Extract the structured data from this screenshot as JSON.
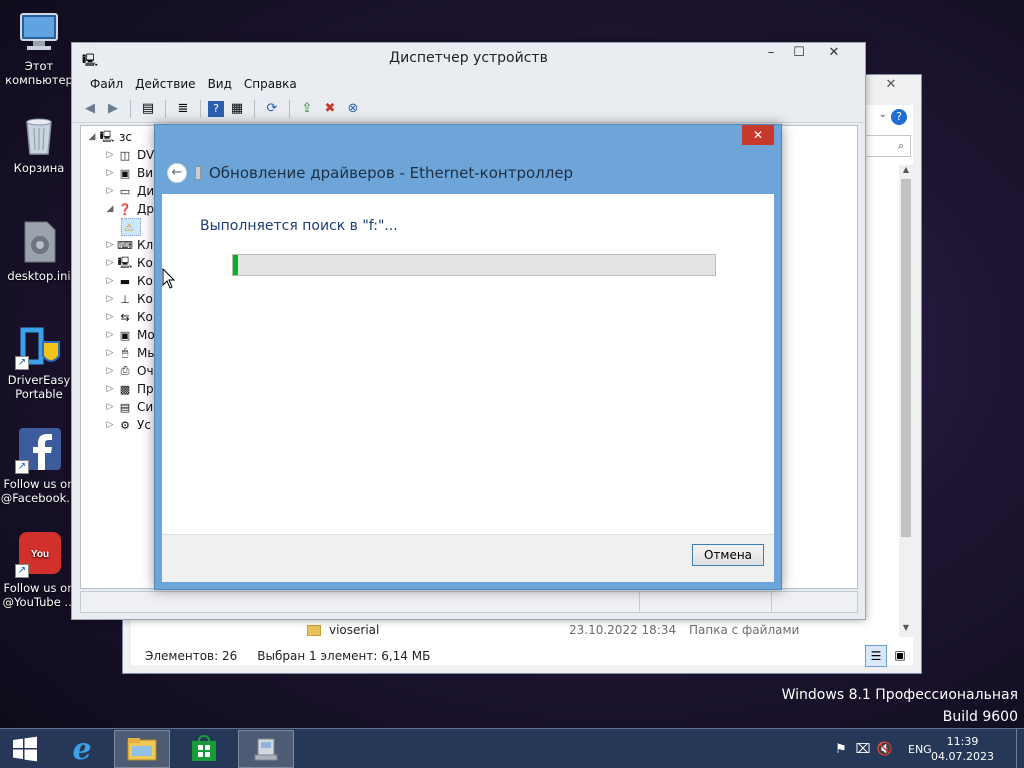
{
  "desktop": {
    "icons": [
      {
        "label": "Этот компьютер",
        "icon": "computer-icon"
      },
      {
        "label": "Корзина",
        "icon": "recycle-bin-icon"
      },
      {
        "label": "desktop.ini",
        "icon": "settings-file-icon"
      },
      {
        "label": "DriverEasy Portable",
        "icon": "drivereasy-icon"
      },
      {
        "label": "Follow us on @Facebook...",
        "icon": "facebook-icon"
      },
      {
        "label": "Follow us on @YouTube ...",
        "icon": "youtube-icon"
      }
    ]
  },
  "explorer": {
    "file_row": {
      "name": "vioserial",
      "date": "23.10.2022 18:34",
      "type": "Папка с файлами"
    },
    "status_count": "Элементов: 26",
    "status_selected": "Выбран 1 элемент: 6,14 МБ",
    "search_icon": "search-icon",
    "help_icon": "help-icon"
  },
  "device_manager": {
    "title": "Диспетчер устройств",
    "menu": [
      "Файл",
      "Действие",
      "Вид",
      "Справка"
    ],
    "tree_root": "зс",
    "tree_items": [
      "DV",
      "Ви",
      "Ди",
      "Др",
      "",
      "Кл",
      "Ко",
      "Ко",
      "Ко",
      "Ко",
      "Мо",
      "Мы",
      "Оч",
      "Пр",
      "Си",
      "Ус"
    ]
  },
  "wizard": {
    "title": "Обновление драйверов - Ethernet-контроллер",
    "message": "Выполняется поиск в \"f:\"...",
    "progress": 0.01,
    "cancel_label": "Отмена",
    "close_icon": "close-icon",
    "back_icon": "back-arrow-icon"
  },
  "watermark": {
    "line1": "Windows 8.1 Профессиональная",
    "line2": "Build 9600"
  },
  "taskbar": {
    "apps": [
      "start-icon",
      "internet-explorer-icon",
      "file-explorer-icon",
      "store-icon",
      "device-manager-icon"
    ],
    "language": "ENG",
    "time": "11:39",
    "date": "04.07.2023"
  },
  "colors": {
    "progress_fill": "#06b025",
    "wizard_frame": "#6ea5d8",
    "close_red": "#c7392b",
    "taskbar": "#283c5c"
  }
}
